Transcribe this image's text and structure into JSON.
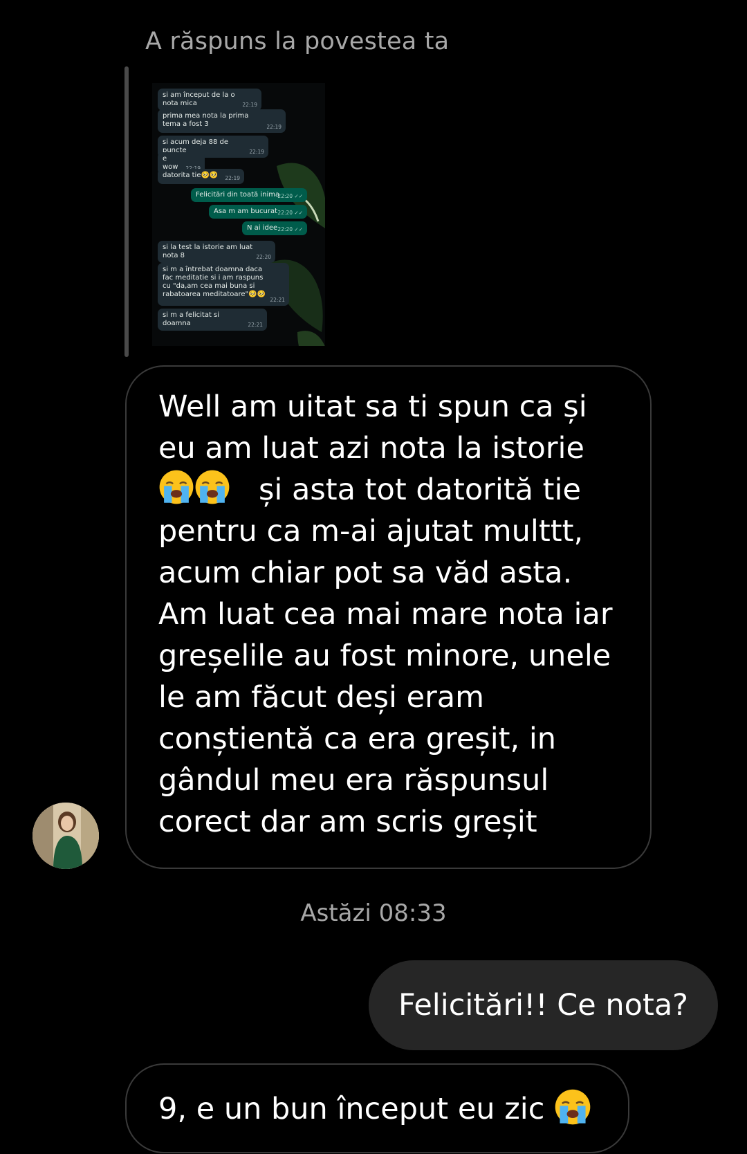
{
  "reply_header": "A răspuns la povestea ta",
  "story": {
    "messages": [
      {
        "dir": "in",
        "text": "si am început de la o nota mica",
        "time": "22:19"
      },
      {
        "dir": "in",
        "text": "prima mea nota la prima tema a fost 3",
        "time": "22:19"
      },
      {
        "dir": "in",
        "text": "si acum deja 88 de puncte",
        "time": "22:19"
      },
      {
        "dir": "in",
        "text": "e wow",
        "time": "22:19"
      },
      {
        "dir": "in",
        "text": "datorita tie🥺🥺",
        "time": "22:19"
      },
      {
        "dir": "out",
        "text": "Felicitări din toată inima",
        "time": "22:20"
      },
      {
        "dir": "out",
        "text": "Asa m am bucurat",
        "time": "22:20"
      },
      {
        "dir": "out",
        "text": "N ai idee",
        "time": "22:20"
      },
      {
        "dir": "in",
        "text": "si la test la istorie am luat nota 8",
        "time": "22:20"
      },
      {
        "dir": "in",
        "text": "si m a întrebat doamna daca fac meditatie si i am raspuns cu \"da,am cea mai buna si rabatoarea meditatoare\"🥺🥺",
        "time": "22:21"
      },
      {
        "dir": "in",
        "text": "si m a felicitat si doamna",
        "time": "22:21"
      }
    ]
  },
  "messages": {
    "msg1": {
      "part1": "Well am uitat sa ti spun ca și eu am luat azi nota la istorie ",
      "emoji": "loudly-crying-face",
      "part2": "   și asta tot datorită tie pentru ca m-ai ajutat multtt, acum chiar pot sa văd asta. Am luat cea mai mare nota iar greșelile au fost minore, unele le am făcut deși eram conștientă ca era greșit, in gândul meu era răspunsul corect dar am scris greșit"
    },
    "timestamp": "Astăzi 08:33",
    "msg2": "Felicitări!! Ce nota?",
    "msg3": "9, e un bun început eu zic "
  },
  "colors": {
    "background": "#000000",
    "incoming_border": "#3a3a3a",
    "outgoing_bubble": "#262626",
    "muted_text": "#a8a8a8",
    "wa_incoming": "#1f2c34",
    "wa_outgoing": "#005c4b"
  }
}
